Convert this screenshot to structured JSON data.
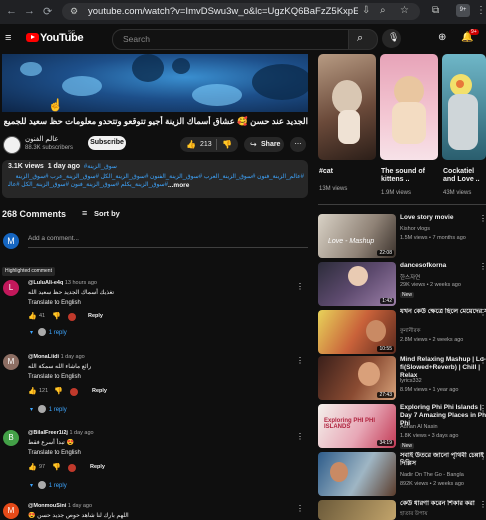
{
  "browser": {
    "url": "youtube.com/watch?v=ImvDSwu3w_o&lc=UgzKQ6BaFzZ5KxpEHQx...",
    "ext_count": "9+"
  },
  "masthead": {
    "logo_text": "YouTube",
    "country_code": "SG",
    "search_placeholder": "Search",
    "notif_count": "9+"
  },
  "video": {
    "title": "الجديد عند حسن 🥰 عشاق أسماك الزينة أجيو تتوقعو وتتحدو معلومات حظ سعيد للجميع للمسابقة"
  },
  "channel": {
    "name": "عالم الفنون",
    "subs": "88.3K subscribers",
    "subscribe_label": "Subscribe",
    "likes": "213",
    "share_label": "Share"
  },
  "description": {
    "views": "3.1K views",
    "age": "1 day ago",
    "tags_line1": "#سوق_الزينة",
    "tags_line2": "#عالم_الزينة_فنون #سوق_الزينة_العرب #سوق_الزينة_الفنون #سوق_الزينة_الكل #سوق_الزينة_عرب #سوق_الزينة",
    "tags_line3": "#سوق_الزينة_يكلم #سوق_الزينة_فنون #سوق_الزينة_الكل #عالم_الزينة",
    "more": "...more"
  },
  "comments": {
    "count": "268 Comments",
    "sort_label": "Sort by",
    "add_placeholder": "Add a comment...",
    "me_initial": "M",
    "highlighted_label": "Highlighted comment",
    "translate_label": "Translate to English",
    "reply_label": "Reply",
    "items": [
      {
        "initial": "L",
        "color": "#c2185b",
        "author": "@LuluAli-e4q",
        "time": "13 hours ago",
        "text": "تغذيك أسماك الجديد حظ سعيد الله",
        "likes": "41",
        "replies": "1 reply"
      },
      {
        "initial": "M",
        "color": "#8d6e63",
        "author": "@MonaLiidi",
        "time": "1 day ago",
        "text": "رائع ماشاء الله سمكة الله",
        "likes": "121",
        "replies": "1 reply"
      },
      {
        "initial": "B",
        "color": "#43a047",
        "author": "@BilalFreer1i2j",
        "time": "1 day ago",
        "text": "😍 تبدأ أسرع فقط",
        "likes": "97",
        "replies": "1 reply"
      },
      {
        "initial": "M",
        "color": "#e64a19",
        "author": "@MonmouSini",
        "time": "1 day ago",
        "text": "اللهم بارك لنا شاهد حوص جديد حسن 😍",
        "likes": "",
        "replies": ""
      }
    ]
  },
  "shorts": [
    {
      "title": "#cat",
      "views": "13M views"
    },
    {
      "title": "The sound of kittens ..",
      "views": "1.9M views"
    },
    {
      "title": "Cockatiel and Love ..",
      "views": "43M views"
    }
  ],
  "related": [
    {
      "title": "Love story movie",
      "channel": "Kishor vlogs",
      "meta": "1.5M views • 7 months ago",
      "duration": "22:08",
      "new": ""
    },
    {
      "title": "dancesofkorna",
      "channel": "한스자연",
      "meta": "29K views • 2 weeks ago",
      "duration": "1:42",
      "new": "New"
    },
    {
      "title": "যখন কেউ ক্ষেত্রে ছিলে মেয়েদের সাথে",
      "channel": "কুনানীরক",
      "meta": "2.8M views • 2 weeks ago",
      "duration": "10:55",
      "new": ""
    },
    {
      "title": "Mind Relaxing Mashup | Lo-fi(Slowed+Reverb) | Chill | Relax",
      "channel": "lyrics332",
      "meta": "8.9M views • 1 year ago",
      "duration": "27:43",
      "new": ""
    },
    {
      "title": "Exploring Phi Phi Islands | Day 7 Amazing Places in Phi Phi",
      "channel": "Adnan Al Nasin",
      "meta": "1.8K views • 3 days ago",
      "duration": "34:19",
      "new": "New"
    },
    {
      "title": "সবাই উতরে জানো পৃথিবী চেন্নাই দিল্লিস",
      "channel": "Nadir On The Go - Bangla",
      "meta": "892K views • 2 weeks ago",
      "duration": "",
      "new": ""
    },
    {
      "title": "কেউ ধারণা করেন শিকার করা",
      "channel": "হাতার উপায়",
      "meta": "",
      "duration": "",
      "new": ""
    }
  ]
}
